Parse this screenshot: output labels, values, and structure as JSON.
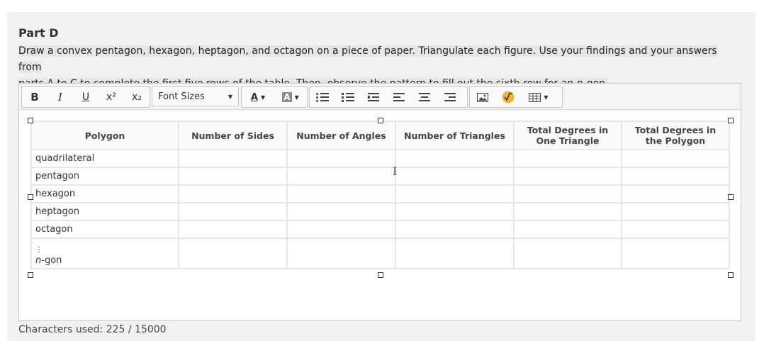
{
  "part": {
    "title": "Part D"
  },
  "prompt": {
    "line1": "Draw a convex pentagon, hexagon, heptagon, and octagon on a piece of paper. Triangulate each figure. Use your findings and your answers from",
    "line2a": "parts A to C to complete the first five rows of the table. Then, observe the pattern to fill out the sixth row for an ",
    "line2_italic": "n",
    "line2b": "-gon."
  },
  "toolbar": {
    "bold": "B",
    "italic": "I",
    "underline": "U",
    "superscript": "x²",
    "subscript": "x₂",
    "font_sizes": "Font Sizes",
    "text_color": "A",
    "bg_color": "A"
  },
  "table": {
    "headers": [
      "Polygon",
      "Number of Sides",
      "Number of Angles",
      "Number of Triangles",
      "Total Degrees in One Triangle",
      "Total Degrees in the Polygon"
    ],
    "rows": [
      "quadrilateral",
      "pentagon",
      "hexagon",
      "heptagon",
      "octagon"
    ],
    "last_row_dots": "⋮",
    "last_row_italic": "n",
    "last_row_suffix": "-gon"
  },
  "counter": {
    "text": "Characters used: 225 / 15000"
  }
}
